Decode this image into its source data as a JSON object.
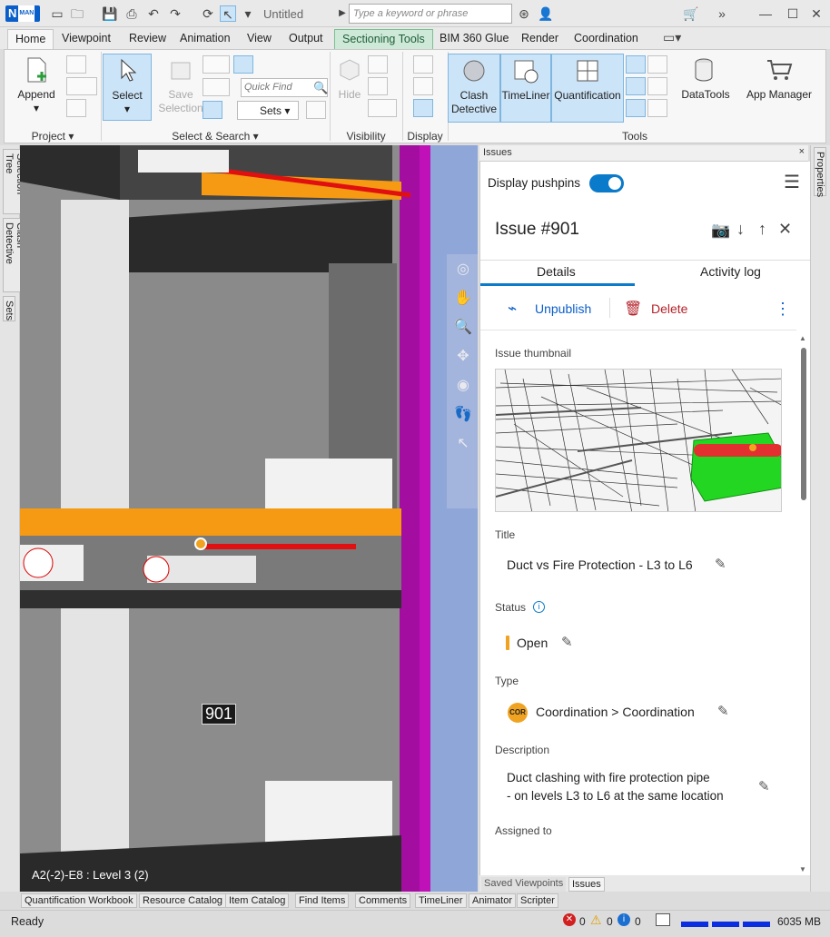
{
  "app": {
    "logo_letter": "N",
    "logo_sub": "MAN",
    "title": "Untitled",
    "search_placeholder": "Type a keyword or phrase"
  },
  "tabs": [
    "Home",
    "Viewpoint",
    "Review",
    "Animation",
    "View",
    "Output",
    "Sectioning Tools",
    "BIM 360 Glue",
    "Render",
    "Coordination"
  ],
  "ribbon": {
    "append": "Append",
    "select": "Select",
    "save_selection_1": "Save",
    "save_selection_2": "Selection",
    "quick_find_placeholder": "Quick Find",
    "sets": "Sets",
    "hide": "Hide",
    "clash_1": "Clash",
    "clash_2": "Detective",
    "timeliner": "TimeLiner",
    "quantification": "Quantification",
    "datatools": "DataTools",
    "app_manager": "App Manager",
    "groups": {
      "project": "Project",
      "select_search": "Select & Search",
      "visibility": "Visibility",
      "display": "Display",
      "tools": "Tools"
    }
  },
  "left_tabs": [
    "Selection Tree",
    "Clash Detective",
    "Sets"
  ],
  "right_tabs": [
    "Properties"
  ],
  "viewport": {
    "pushpin_label": "901",
    "status": "A2(-2)-E8 : Level 3 (2)"
  },
  "panel": {
    "header": "Issues",
    "display_pushpins": "Display pushpins",
    "issue_title": "Issue #901",
    "tab_details": "Details",
    "tab_activity": "Activity log",
    "unpublish": "Unpublish",
    "delete": "Delete",
    "thumbnail_label": "Issue thumbnail",
    "title_label": "Title",
    "title_value": "Duct vs Fire Protection - L3 to L6",
    "status_label": "Status",
    "status_value": "Open",
    "type_label": "Type",
    "type_badge": "COR",
    "type_value": "Coordination > Coordination",
    "description_label": "Description",
    "description_line1": "Duct clashing with fire protection pipe",
    "description_line2": "- on levels L3 to L6 at the same location",
    "assigned_label": "Assigned to"
  },
  "panel_tabs": [
    "Saved Viewpoints",
    "Issues"
  ],
  "bottom_tabs": [
    "Quantification Workbook",
    "Resource Catalog",
    "Item Catalog",
    "Find Items",
    "Comments",
    "TimeLiner",
    "Animator",
    "Scripter"
  ],
  "status": {
    "ready": "Ready",
    "errors": "0",
    "warnings": "0",
    "info": "0",
    "memory": "6035 MB"
  },
  "colors": {
    "accent": "#0a7acb",
    "status_open": "#f0a321",
    "delete": "#b4232a",
    "model_orange": "#f59a12",
    "model_magenta": "#c010b8",
    "pipe_red": "#e01010"
  }
}
